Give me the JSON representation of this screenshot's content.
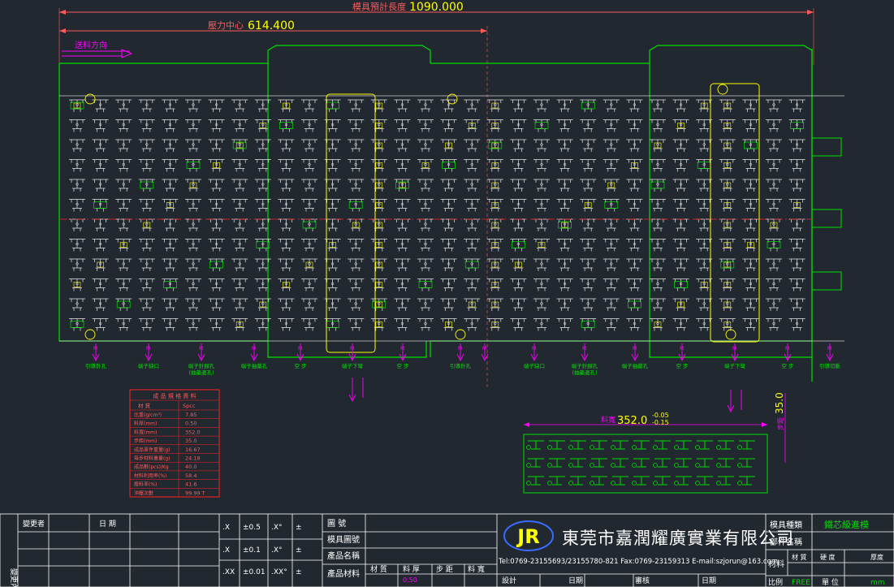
{
  "dimensions": {
    "total_length": {
      "label": "模具預計長度",
      "value": "1090.000"
    },
    "pressure_center": {
      "label": "壓力中心",
      "value": "614.400"
    },
    "feed_direction": "送料方向"
  },
  "station_labels": [
    "引導針孔",
    "端子缺口",
    "端子針腳孔\n(抽藥邊孔)",
    "端子抽藥孔",
    "空  步",
    "端子下彎",
    "空  步",
    "引導針孔",
    "端子缺口",
    "端子針腳孔\n(抽藥邊孔)",
    "端子抽藥孔",
    "空  步",
    "端子下彎",
    "空  步",
    "引導切斷"
  ],
  "direction_mark": "M",
  "material_table": {
    "title": "成 品 規 格 資 料",
    "header": [
      "材  質",
      "Spcc"
    ],
    "rows": [
      [
        "比重(g/cm³)",
        "7.85"
      ],
      [
        "料厚(mm)",
        "0.50"
      ],
      [
        "料寬(mm)",
        "352.0"
      ],
      [
        "步距(mm)",
        "35.0"
      ],
      [
        "成品單件重量(g)",
        "16.67"
      ],
      [
        "每步材料重量(g)",
        "24.18"
      ],
      [
        "成品數(pcs)/Kg",
        "40.0"
      ],
      [
        "材料利用率(%)",
        "58.4"
      ],
      [
        "廢料率(%)",
        "41.6"
      ],
      [
        "沖壓次數",
        "99.99 T"
      ]
    ]
  },
  "strip": {
    "width_label": "料寬",
    "width_value": "352.0",
    "tol_upper": "-0.05",
    "tol_lower": "-0.15",
    "pitch_label": "步距",
    "pitch_value": "35.0"
  },
  "title_block": {
    "revision": {
      "label": "變更者",
      "date_label": "日  期",
      "side": "變更內容"
    },
    "tolerances": [
      {
        "a": ".X",
        "b": "±0.5",
        "c": ".X°",
        "d": "±"
      },
      {
        "a": ".X",
        "b": "±0.1",
        "c": ".X°",
        "d": "±"
      },
      {
        "a": ".XX",
        "b": "±0.01",
        "c": ".XX°",
        "d": "±"
      }
    ],
    "fields": [
      "圖    號",
      "模具圖號",
      "產品名稱",
      "產品材料"
    ],
    "material_cols": [
      "材  質",
      "料  厚",
      "步  距",
      "料  寬"
    ],
    "material_thickness": "0.50",
    "company": {
      "logo": "JR",
      "name": "東莞市嘉潤耀廣實業有限公司",
      "contact": "Tel:0769-23155693/23155780-821  Fax:0769-23159313  E-mail:szjorun@163.com"
    },
    "sign_row": [
      "設計",
      "日期",
      "審核",
      "日期"
    ],
    "right": {
      "mold_type_label": "模具種類",
      "mold_type_value": "鐵芯級進模",
      "part_name_label": "部件名稱",
      "material_label": "材料",
      "material_cols": [
        "材  質",
        "硬  度",
        "厚度"
      ],
      "scale_label": "比例",
      "scale_value": "FREE",
      "unit_label": "單  位",
      "unit_value": "mm"
    }
  },
  "colors": {
    "background": "#212830",
    "outline": "#00e000",
    "part": "#e8e8e8",
    "annotation": "#ff00ff",
    "dimension": "#ff5a5a",
    "highlight": "#ffff00",
    "centerline": "#ff2020",
    "frame": "#ffffff"
  }
}
